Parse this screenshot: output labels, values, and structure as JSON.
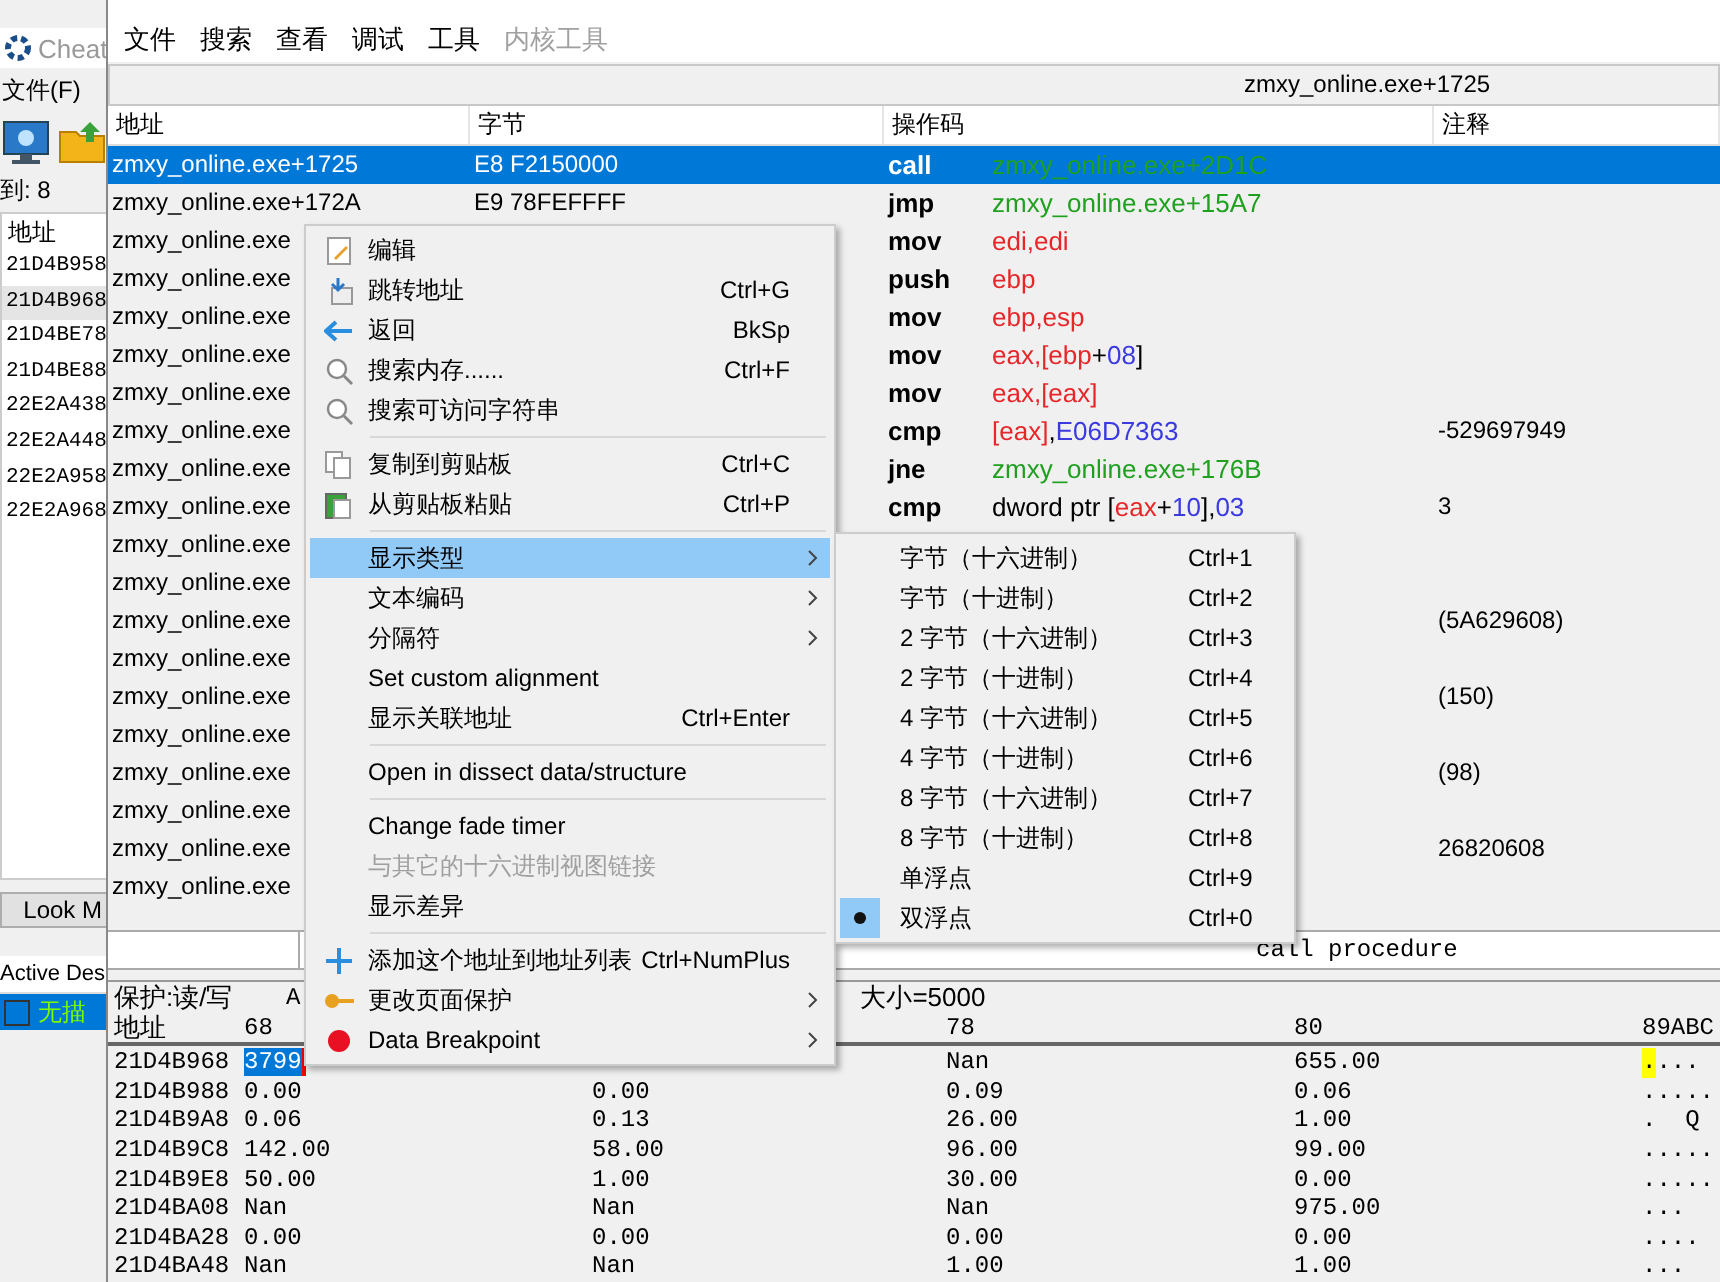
{
  "background_window": {
    "title": "Cheat",
    "menu": [
      "文件(F)"
    ],
    "found": "到: 8",
    "list_header": "地址",
    "addresses": [
      {
        "text": "21D4B958",
        "selected": false
      },
      {
        "text": "21D4B968",
        "selected": true
      },
      {
        "text": "21D4BE78",
        "selected": false
      },
      {
        "text": "21D4BE88",
        "selected": false
      },
      {
        "text": "22E2A438",
        "selected": false
      },
      {
        "text": "22E2A448",
        "selected": false
      },
      {
        "text": "22E2A958",
        "selected": false
      },
      {
        "text": "22E2A968",
        "selected": false
      }
    ],
    "look_button": "Look M",
    "table_columns": [
      "Active",
      "Des"
    ],
    "table_rows": [
      {
        "checked": false,
        "description": "无描",
        "selected": true
      }
    ]
  },
  "memory_viewer": {
    "menu": [
      {
        "label": "文件",
        "disabled": false
      },
      {
        "label": "搜索",
        "disabled": false
      },
      {
        "label": "查看",
        "disabled": false
      },
      {
        "label": "调试",
        "disabled": false
      },
      {
        "label": "工具",
        "disabled": false
      },
      {
        "label": "内核工具",
        "disabled": true
      }
    ],
    "location": "zmxy_online.exe+1725",
    "columns": [
      "地址",
      "字节",
      "操作码",
      "注释"
    ],
    "rows": [
      {
        "address": "zmxy_online.exe+1725",
        "bytes": "E8 F2150000",
        "opcode": "call",
        "operands": [
          {
            "text": "zmxy_online.exe+2D1C",
            "kind": "symbol"
          }
        ],
        "selected": true
      },
      {
        "address": "zmxy_online.exe+172A",
        "bytes": "E9 78FEFFFF",
        "opcode": "jmp",
        "operands": [
          {
            "text": "zmxy_online.exe+15A7",
            "kind": "symbol"
          }
        ],
        "selected": false
      },
      {
        "address": "zmxy_online.exe",
        "opcode": "mov",
        "operands": [
          {
            "text": "edi,edi",
            "kind": "register"
          }
        ],
        "selected": false
      },
      {
        "address": "zmxy_online.exe",
        "opcode": "push",
        "operands": [
          {
            "text": "ebp",
            "kind": "register"
          }
        ],
        "selected": false
      },
      {
        "address": "zmxy_online.exe",
        "opcode": "mov",
        "operands": [
          {
            "text": "ebp,esp",
            "kind": "register"
          }
        ],
        "selected": false
      },
      {
        "address": "zmxy_online.exe",
        "opcode": "mov",
        "operands": [
          {
            "text": "eax,[ebp",
            "kind": "register"
          },
          {
            "text": "+",
            "kind": "plain"
          },
          {
            "text": "08",
            "kind": "number"
          },
          {
            "text": "]",
            "kind": "plain"
          }
        ],
        "selected": false
      },
      {
        "address": "zmxy_online.exe",
        "opcode": "mov",
        "operands": [
          {
            "text": "eax,[eax]",
            "kind": "register"
          }
        ],
        "selected": false
      },
      {
        "address": "zmxy_online.exe",
        "opcode": "cmp",
        "operands": [
          {
            "text": "[eax]",
            "kind": "register"
          },
          {
            "text": ",",
            "kind": "plain"
          },
          {
            "text": "E06D7363",
            "kind": "number"
          }
        ],
        "comment": "-529697949",
        "selected": false
      },
      {
        "address": "zmxy_online.exe",
        "opcode": "jne",
        "operands": [
          {
            "text": "zmxy_online.exe+176B",
            "kind": "symbol"
          }
        ],
        "selected": false
      },
      {
        "address": "zmxy_online.exe",
        "opcode": "cmp",
        "operands": [
          {
            "text": "dword ptr [",
            "kind": "plain"
          },
          {
            "text": "eax",
            "kind": "register"
          },
          {
            "text": "+",
            "kind": "plain"
          },
          {
            "text": "10",
            "kind": "number"
          },
          {
            "text": "],",
            "kind": "plain"
          },
          {
            "text": "03",
            "kind": "number"
          }
        ],
        "comment": "3",
        "selected": false
      },
      {
        "address": "zmxy_online.exe",
        "selected": false
      },
      {
        "address": "zmxy_online.exe",
        "selected": false
      },
      {
        "address": "zmxy_online.exe",
        "comment": "(5A629608)",
        "selected": false
      },
      {
        "address": "zmxy_online.exe",
        "selected": false
      },
      {
        "address": "zmxy_online.exe",
        "comment": "(150)",
        "selected": false
      },
      {
        "address": "zmxy_online.exe",
        "selected": false
      },
      {
        "address": "zmxy_online.exe",
        "comment": "(98)",
        "selected": false
      },
      {
        "address": "zmxy_online.exe",
        "selected": false
      },
      {
        "address": "zmxy_online.exe",
        "comment": "26820608",
        "selected": false
      },
      {
        "address": "zmxy_online.exe",
        "selected": false
      }
    ],
    "instruction_hint": "call procedure",
    "hex": {
      "protection": "保护:读/写",
      "info": "A",
      "size": "大小=5000",
      "header": {
        "address": "地址",
        "col_68": "68",
        "col_78": "78",
        "col_80": "80",
        "ascii": "89ABC"
      },
      "rows": [
        {
          "address": "21D4B968",
          "col_68": "3799",
          "col_78": "Nan",
          "col_80": "655.00",
          "ascii": "....",
          "selected": true
        },
        {
          "address": "21D4B988",
          "col_68": "0.00",
          "col_70": "0.00",
          "col_78": "0.09",
          "col_80": "0.06",
          "ascii": ".....",
          "selected": false
        },
        {
          "address": "21D4B9A8",
          "col_68": "0.06",
          "col_70": "0.13",
          "col_78": "26.00",
          "col_80": "1.00",
          "ascii": ".  Q",
          "selected": false
        },
        {
          "address": "21D4B9C8",
          "col_68": "142.00",
          "col_70": "58.00",
          "col_78": "96.00",
          "col_80": "99.00",
          "ascii": ".....",
          "selected": false
        },
        {
          "address": "21D4B9E8",
          "col_68": "50.00",
          "col_70": "1.00",
          "col_78": "30.00",
          "col_80": "0.00",
          "ascii": ".....",
          "selected": false
        },
        {
          "address": "21D4BA08",
          "col_68": "Nan",
          "col_70": "Nan",
          "col_78": "Nan",
          "col_80": "975.00",
          "ascii": "...",
          "selected": false
        },
        {
          "address": "21D4BA28",
          "col_68": "0.00",
          "col_70": "0.00",
          "col_78": "0.00",
          "col_80": "0.00",
          "ascii": "....",
          "selected": false
        },
        {
          "address": "21D4BA48",
          "col_68": "Nan",
          "col_70": "Nan",
          "col_78": "1.00",
          "col_80": "1.00",
          "ascii": "...",
          "selected": false
        }
      ]
    }
  },
  "context_menu": {
    "groups": [
      [
        {
          "label": "编辑",
          "selected": false,
          "submenu": false,
          "disabled": false
        },
        {
          "label": "跳转地址",
          "shortcut": "Ctrl+G",
          "selected": false,
          "submenu": false,
          "disabled": false
        },
        {
          "label": "返回",
          "shortcut": "BkSp",
          "selected": false,
          "submenu": false,
          "disabled": false
        },
        {
          "label": "搜索内存......",
          "shortcut": "Ctrl+F",
          "selected": false,
          "submenu": false,
          "disabled": false
        },
        {
          "label": "搜索可访问字符串",
          "selected": false,
          "submenu": false,
          "disabled": false
        }
      ],
      [
        {
          "label": "复制到剪贴板",
          "shortcut": "Ctrl+C",
          "selected": false,
          "submenu": false,
          "disabled": false
        },
        {
          "label": "从剪贴板粘贴",
          "shortcut": "Ctrl+P",
          "selected": false,
          "submenu": false,
          "disabled": false
        }
      ],
      [
        {
          "label": "显示类型",
          "selected": true,
          "submenu": true,
          "disabled": false
        },
        {
          "label": "文本编码",
          "selected": false,
          "submenu": true,
          "disabled": false
        },
        {
          "label": "分隔符",
          "selected": false,
          "submenu": true,
          "disabled": false
        },
        {
          "label": "Set custom alignment",
          "selected": false,
          "submenu": false,
          "disabled": false
        },
        {
          "label": "显示关联地址",
          "shortcut": "Ctrl+Enter",
          "selected": false,
          "submenu": false,
          "disabled": false
        }
      ],
      [
        {
          "label": "Open in dissect data/structure",
          "selected": false,
          "submenu": false,
          "disabled": false
        }
      ],
      [
        {
          "label": "Change fade timer",
          "selected": false,
          "submenu": false,
          "disabled": false
        },
        {
          "label": "与其它的十六进制视图链接",
          "selected": false,
          "submenu": false,
          "disabled": true
        },
        {
          "label": "显示差异",
          "selected": false,
          "submenu": false,
          "disabled": false
        }
      ],
      [
        {
          "label": "添加这个地址到地址列表",
          "shortcut": "Ctrl+NumPlus",
          "selected": false,
          "submenu": false,
          "disabled": false
        },
        {
          "label": "更改页面保护",
          "selected": false,
          "submenu": true,
          "disabled": false
        },
        {
          "label": "Data Breakpoint",
          "selected": false,
          "submenu": true,
          "disabled": false
        }
      ]
    ]
  },
  "display_type_menu": {
    "items": [
      {
        "label": "字节（十六进制）",
        "shortcut": "Ctrl+1",
        "checked": false
      },
      {
        "label": "字节（十进制）",
        "shortcut": "Ctrl+2",
        "checked": false
      },
      {
        "label": "2 字节（十六进制）",
        "shortcut": "Ctrl+3",
        "checked": false
      },
      {
        "label": "2 字节（十进制）",
        "shortcut": "Ctrl+4",
        "checked": false
      },
      {
        "label": "4 字节（十六进制）",
        "shortcut": "Ctrl+5",
        "checked": false
      },
      {
        "label": "4 字节（十进制）",
        "shortcut": "Ctrl+6",
        "checked": false
      },
      {
        "label": "8 字节（十六进制）",
        "shortcut": "Ctrl+7",
        "checked": false
      },
      {
        "label": "8 字节（十进制）",
        "shortcut": "Ctrl+8",
        "checked": false
      },
      {
        "label": "单浮点",
        "shortcut": "Ctrl+9",
        "checked": false
      },
      {
        "label": "双浮点",
        "shortcut": "Ctrl+0",
        "checked": true
      }
    ]
  }
}
